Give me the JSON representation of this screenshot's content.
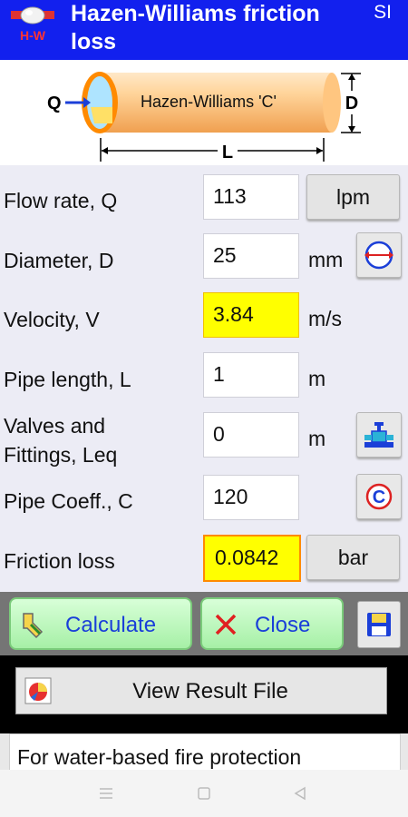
{
  "app": {
    "logo_text": "H-W",
    "title": "Hazen-Williams friction loss",
    "unit_system": "SI"
  },
  "diagram": {
    "q_label": "Q",
    "c_label": "Hazen-Williams 'C'",
    "d_label": "D",
    "l_label": "L"
  },
  "form": {
    "flow_rate": {
      "label": "Flow rate, Q",
      "value": "113",
      "unit_button": "lpm"
    },
    "diameter": {
      "label": "Diameter, D",
      "value": "25",
      "unit": "mm"
    },
    "velocity": {
      "label": "Velocity, V",
      "value": "3.84",
      "unit": "m/s"
    },
    "pipe_length": {
      "label": "Pipe length, L",
      "value": "1",
      "unit": "m"
    },
    "valves": {
      "label_line1": "Valves and",
      "label_line2": "Fittings, Leq",
      "value": "0",
      "unit": "m"
    },
    "pipe_coeff": {
      "label": "Pipe Coeff., C",
      "value": "120",
      "button_glyph": "C"
    },
    "friction_loss": {
      "label": "Friction loss",
      "value": "0.0842",
      "unit_button": "bar"
    }
  },
  "actions": {
    "calculate_label": "Calculate",
    "close_label": "Close"
  },
  "result": {
    "view_result_label": "View Result File"
  },
  "note": {
    "text": "For water-based fire protection"
  },
  "colors": {
    "appbar": "#1220ee",
    "highlight": "#ffff00",
    "friction_border": "#ff8a00",
    "action_text": "#1a3fd9"
  }
}
